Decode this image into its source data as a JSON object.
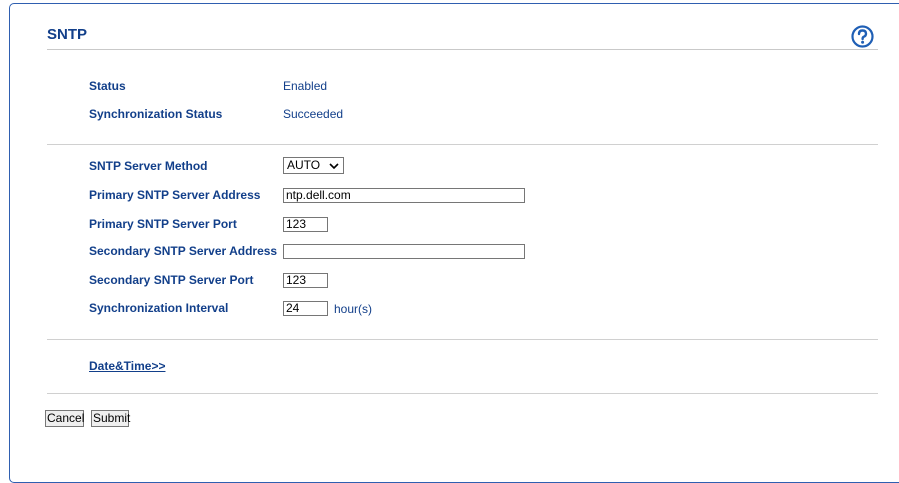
{
  "page": {
    "title": "SNTP"
  },
  "status": {
    "status_label": "Status",
    "status_value": "Enabled",
    "sync_status_label": "Synchronization Status",
    "sync_status_value": "Succeeded"
  },
  "settings": {
    "method_label": "SNTP Server Method",
    "method_value": "AUTO",
    "primary_address_label": "Primary SNTP Server Address",
    "primary_address_value": "ntp.dell.com",
    "primary_port_label": "Primary SNTP Server Port",
    "primary_port_value": "123",
    "secondary_address_label": "Secondary SNTP Server Address",
    "secondary_address_value": "",
    "secondary_port_label": "Secondary SNTP Server Port",
    "secondary_port_value": "123",
    "interval_label": "Synchronization Interval",
    "interval_value": "24",
    "interval_unit": "hour(s)"
  },
  "links": {
    "date_time": "Date&Time>>"
  },
  "buttons": {
    "cancel": "Cancel",
    "submit": "Submit"
  },
  "icons": {
    "help": "help-icon",
    "dropdown": "chevron-down-icon"
  },
  "colors": {
    "accent": "#123f8a",
    "frame": "#2f5fb0"
  }
}
